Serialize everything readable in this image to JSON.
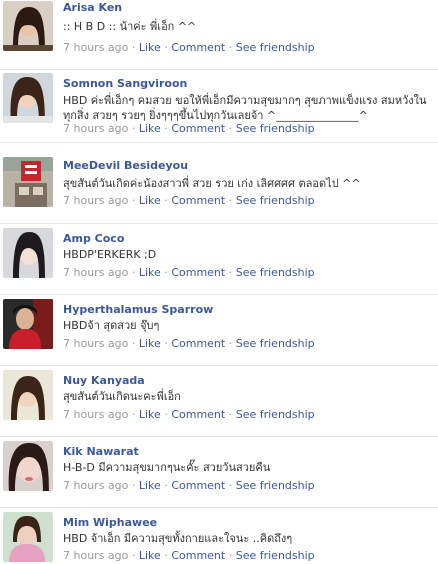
{
  "posts": [
    {
      "name": "Arisa Ken",
      "message": ":: H B D :: น้าค่ะ พี่เอ็ก ^^",
      "time": "7 hours ago",
      "avatar": "avatar-woman-dark-hair"
    },
    {
      "name": "Somnon Sangviroon",
      "message": "HBD ค่ะพี่เอ็กๆ คมสวย ขอให้พี่เอ็กมีความสุขมากๆ สุขภาพแข็งแรง สมหวังในทุกสิ่ง สวยๆ รวยๆ ยิ่งๆๆๆขึ้นไปทุกวันเลยจ้า ^_______________^",
      "time": "7 hours ago",
      "avatar": "avatar-woman-long-hair"
    },
    {
      "name": "MeeDevil Besideyou",
      "message": "สุขสันต์วันเกิดค่ะน้องสาวพี่ สวย รวย เก่ง เลิศศศศ ตลอดไป ^^",
      "time": "7 hours ago",
      "avatar": "avatar-building-sign"
    },
    {
      "name": "Amp Coco",
      "message": "HBDP'ERKERK ;D",
      "time": "7 hours ago",
      "avatar": "avatar-woman-pale"
    },
    {
      "name": "Hyperthalamus Sparrow",
      "message": "HBDจ้า สุดสวย จุ๊บๆ",
      "time": "7 hours ago",
      "avatar": "avatar-man-red-shirt"
    },
    {
      "name": "Nuy Kanyada",
      "message": "สุขสันต์วันเกิดนะคะพี่เอ็ก",
      "time": "7 hours ago",
      "avatar": "avatar-woman-bright"
    },
    {
      "name": "Kik Nawarat",
      "message": "H-B-D มีความสุขมากๆนะคั๊ะ สวยวันสวยคืน",
      "time": "7 hours ago",
      "avatar": "avatar-woman-closeup"
    },
    {
      "name": "Mim Wiphawee",
      "message": "HBD จ้าเอ็ก มีความสุขทั้งกายและใจนะ ..คิดถึงๆ",
      "time": "7 hours ago",
      "avatar": "avatar-woman-pink"
    }
  ],
  "actions": {
    "separator": "·",
    "like": "Like",
    "comment": "Comment",
    "see_friendship": "See friendship"
  },
  "colors": {
    "link": "#3b5998",
    "meta": "#999999",
    "text": "#333333",
    "divider": "#e9e9e9"
  }
}
